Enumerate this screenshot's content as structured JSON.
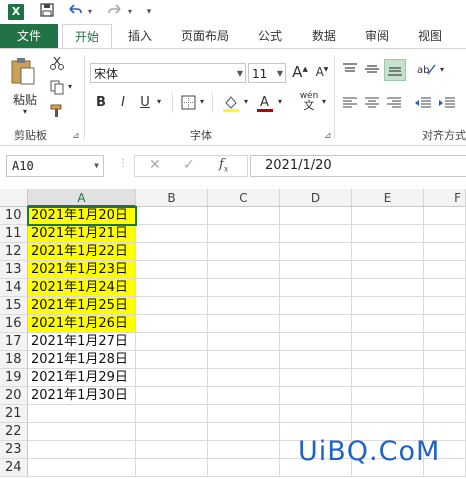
{
  "qat": {
    "logo": "X"
  },
  "tabs": [
    {
      "label": "文件"
    },
    {
      "label": "开始"
    },
    {
      "label": "插入"
    },
    {
      "label": "页面布局"
    },
    {
      "label": "公式"
    },
    {
      "label": "数据"
    },
    {
      "label": "审阅"
    },
    {
      "label": "视图"
    }
  ],
  "ribbon": {
    "clipboard": {
      "paste_label": "粘贴",
      "group_label": "剪贴板"
    },
    "font": {
      "font_name": "宋体",
      "font_size": "11",
      "group_label": "字体",
      "bold": "B",
      "italic": "I",
      "underline": "U",
      "grow": "A",
      "shrink": "A",
      "phonetic": "wén"
    },
    "alignment": {
      "group_label": "对齐方式"
    },
    "colors": {
      "accent": "#217346",
      "highlight": "#ffff00",
      "font_color": "#c00000"
    }
  },
  "formula_bar": {
    "name_box": "A10",
    "formula": "2021/1/20"
  },
  "grid": {
    "columns": [
      "A",
      "B",
      "C",
      "D",
      "E",
      "F"
    ],
    "rows": [
      {
        "num": "10",
        "a": "2021年1月20日",
        "highlight": true
      },
      {
        "num": "11",
        "a": "2021年1月21日",
        "highlight": true
      },
      {
        "num": "12",
        "a": "2021年1月22日",
        "highlight": true
      },
      {
        "num": "13",
        "a": "2021年1月23日",
        "highlight": true
      },
      {
        "num": "14",
        "a": "2021年1月24日",
        "highlight": true
      },
      {
        "num": "15",
        "a": "2021年1月25日",
        "highlight": true
      },
      {
        "num": "16",
        "a": "2021年1月26日",
        "highlight": true
      },
      {
        "num": "17",
        "a": "2021年1月27日",
        "highlight": false
      },
      {
        "num": "18",
        "a": "2021年1月28日",
        "highlight": false
      },
      {
        "num": "19",
        "a": "2021年1月29日",
        "highlight": false
      },
      {
        "num": "20",
        "a": "2021年1月30日",
        "highlight": false
      },
      {
        "num": "21",
        "a": "",
        "highlight": false
      },
      {
        "num": "22",
        "a": "",
        "highlight": false
      },
      {
        "num": "23",
        "a": "",
        "highlight": false
      },
      {
        "num": "24",
        "a": "",
        "highlight": false
      }
    ]
  },
  "watermark": "UiBQ.CoM"
}
